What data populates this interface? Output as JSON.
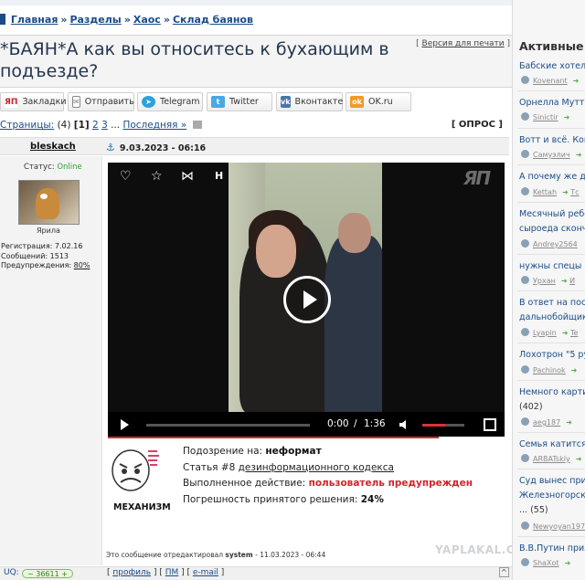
{
  "breadcrumb": {
    "items": [
      "Главная",
      "Разделы",
      "Хаос",
      "Склад баянов"
    ],
    "separator": "»"
  },
  "post": {
    "title_line1": "*БАЯН*А как вы относитесь к бухающим в",
    "title_line2": "подъезде?",
    "print_version": "Версия для печати",
    "author": "bleskach",
    "date": "9.03.2023 - 06:16"
  },
  "share": {
    "bookmarks": "Закладки",
    "send": "Отправить",
    "telegram": "Telegram",
    "twitter": "Twitter",
    "vk": "Вконтакте",
    "ok": "OK.ru"
  },
  "pager": {
    "label": "Страницы:",
    "count": "(4)",
    "current": "[1]",
    "page2": "2",
    "page3": "3",
    "ellipsis": "...",
    "last": "Последняя »",
    "poll": "[ ОПРОС ]"
  },
  "user": {
    "status_label": "Статус:",
    "status_value": "Online",
    "avatar_name": "Ярила",
    "registration": "Регистрация: 7.02.16",
    "messages": "Сообщений: 1513",
    "warnings_label": "Предупреждения:",
    "warnings_value": "80%"
  },
  "video": {
    "top_letter": "Н",
    "logo": "ЯП",
    "time_current": "0:00",
    "time_sep": "/",
    "time_total": "1:36",
    "volume_level": 0.55
  },
  "moderation": {
    "mechanism": "МЕХАНИЗМ",
    "suspicion_label": "Подозрение на:",
    "suspicion_value": "неформат",
    "article_label": "Статья #8",
    "article_link": "дезинформационного кодекса",
    "action_label": "Выполненное действие:",
    "action_value": "пользователь предупрежден",
    "error_label": "Погрешность принятого решения:",
    "error_value": "24%"
  },
  "edited": {
    "prefix": "Это сообщение отредактировал",
    "who": "system",
    "when": "- 11.03.2023 - 06:44"
  },
  "footer": {
    "uq_label": "UQ:",
    "uq_value": "36611",
    "profile": "профиль",
    "pm": "ПМ",
    "email": "e-mail",
    "top": "^"
  },
  "watermark": "YAPLAKAL.COM",
  "sidebar": {
    "title": "Активные т",
    "items": [
      {
        "topic": "Бабские хотелк",
        "user": "Kovenant"
      },
      {
        "topic": "Орнелла Мутти",
        "user": "Sinictir"
      },
      {
        "topic": "Вотт и всё. Кон",
        "user": "Самуэлич"
      },
      {
        "topic": "А почему же де",
        "user": "Kettah",
        "user2": "Тс"
      },
      {
        "topic": "Месячный ребе",
        "topic2": "сыроеда скончи",
        "user": "Andrey2564"
      },
      {
        "topic": "нужны спецы (5",
        "user": "Урхан",
        "user2": "И"
      },
      {
        "topic": "В ответ на пост",
        "topic2": "дальнобойщика",
        "user": "Lyapin",
        "user2": "Te"
      },
      {
        "topic": "Лохотрон \"5 руб",
        "user": "Pachinok"
      },
      {
        "topic": "Немного картин",
        "topic2": "(402)",
        "user": "aeg187"
      },
      {
        "topic": "Семья катится",
        "user": "ARBATskiy"
      },
      {
        "topic": "Суд вынес приг",
        "topic2": "Железногорска",
        "topic3": "... (55)",
        "user": "Newyoyan197"
      },
      {
        "topic": "В.В.Путин прил",
        "user": "ShaXot"
      }
    ]
  }
}
